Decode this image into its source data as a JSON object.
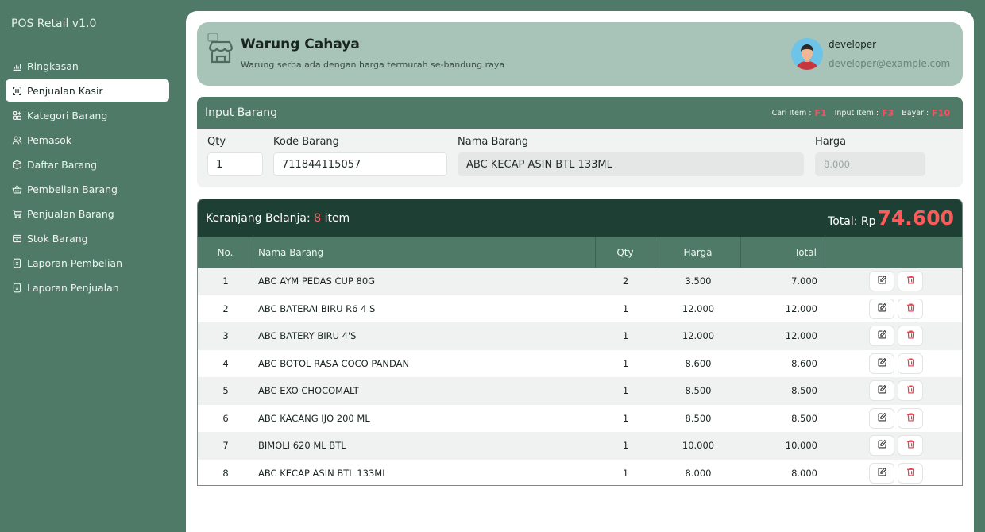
{
  "app": {
    "title": "POS Retail v1.0"
  },
  "sidebar": {
    "items": [
      {
        "label": "Ringkasan",
        "icon": "chart-icon",
        "active": false
      },
      {
        "label": "Penjualan Kasir",
        "icon": "scan-icon",
        "active": true
      },
      {
        "label": "Kategori Barang",
        "icon": "grid-icon",
        "active": false
      },
      {
        "label": "Pemasok",
        "icon": "users-icon",
        "active": false
      },
      {
        "label": "Daftar Barang",
        "icon": "box-icon",
        "active": false
      },
      {
        "label": "Pembelian Barang",
        "icon": "basket-icon",
        "active": false
      },
      {
        "label": "Penjualan Barang",
        "icon": "cart-icon",
        "active": false
      },
      {
        "label": "Stok Barang",
        "icon": "archive-icon",
        "active": false
      },
      {
        "label": "Laporan Pembelian",
        "icon": "file-icon",
        "active": false
      },
      {
        "label": "Laporan Penjualan",
        "icon": "file-icon",
        "active": false
      }
    ]
  },
  "store": {
    "name": "Warung Cahaya",
    "tagline": "Warung serba ada dengan harga termurah se-bandung raya"
  },
  "user": {
    "name": "developer",
    "email": "developer@example.com"
  },
  "input": {
    "title": "Input Barang",
    "shortcuts": [
      {
        "label": "Cari Item :",
        "key": "F1"
      },
      {
        "label": "Input Item :",
        "key": "F3"
      },
      {
        "label": "Bayar :",
        "key": "F10"
      }
    ],
    "qty_label": "Qty",
    "qty_value": "1",
    "kode_label": "Kode Barang",
    "kode_value": "711844115057",
    "nama_label": "Nama Barang",
    "nama_value": "ABC KECAP ASIN BTL 133ML",
    "harga_label": "Harga",
    "harga_value": "8.000"
  },
  "cart": {
    "title_prefix": "Keranjang Belanja:",
    "count": "8",
    "count_suffix": "item",
    "total_label": "Total: Rp",
    "total_value": "74.600",
    "columns": [
      "No.",
      "Nama Barang",
      "Qty",
      "Harga",
      "Total"
    ],
    "rows": [
      {
        "no": "1",
        "name": "ABC AYM PEDAS CUP 80G",
        "qty": "2",
        "harga": "3.500",
        "total": "7.000"
      },
      {
        "no": "2",
        "name": "ABC BATERAI BIRU R6 4 S",
        "qty": "1",
        "harga": "12.000",
        "total": "12.000"
      },
      {
        "no": "3",
        "name": "ABC BATERY BIRU 4'S",
        "qty": "1",
        "harga": "12.000",
        "total": "12.000"
      },
      {
        "no": "4",
        "name": "ABC BOTOL RASA COCO PANDAN",
        "qty": "1",
        "harga": "8.600",
        "total": "8.600"
      },
      {
        "no": "5",
        "name": "ABC EXO CHOCOMALT",
        "qty": "1",
        "harga": "8.500",
        "total": "8.500"
      },
      {
        "no": "6",
        "name": "ABC KACANG IJO 200 ML",
        "qty": "1",
        "harga": "8.500",
        "total": "8.500"
      },
      {
        "no": "7",
        "name": "BIMOLI 620 ML BTL",
        "qty": "1",
        "harga": "10.000",
        "total": "10.000"
      },
      {
        "no": "8",
        "name": "ABC KECAP ASIN BTL 133ML",
        "qty": "1",
        "harga": "8.000",
        "total": "8.000"
      }
    ]
  },
  "colors": {
    "primary": "#4e7a67",
    "dark": "#1e4034",
    "accent_red": "#ff5a5a",
    "header_bg": "#a8c4b8"
  }
}
